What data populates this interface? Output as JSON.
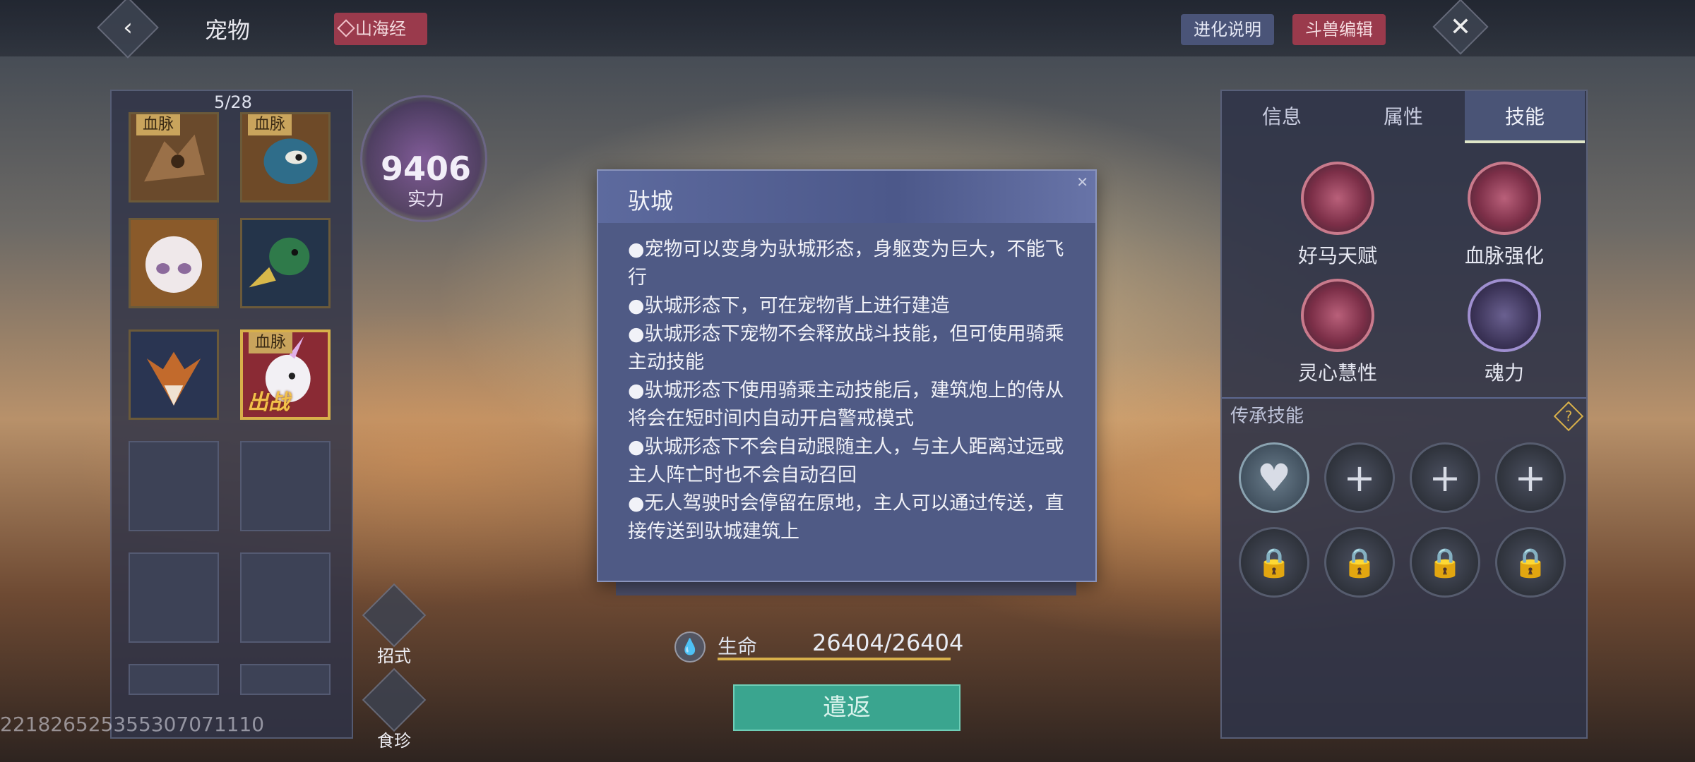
{
  "header": {
    "title": "宠物",
    "shanhai_label": "山海经",
    "evolution_label": "进化说明",
    "beast_edit_label": "斗兽编辑"
  },
  "pet_list": {
    "count": "5/28",
    "bloodline_tag": "血脉",
    "deploy_tag": "出战"
  },
  "power": {
    "value": "9406",
    "label": "实力"
  },
  "side_buttons": {
    "moves": "招式",
    "food": "食珍"
  },
  "stats": {
    "hp_label": "生命",
    "hp_value": "26404/26404"
  },
  "dismiss_label": "遣返",
  "user_id": "221826525355307071110",
  "modal": {
    "title": "驮城",
    "lines": [
      "●宠物可以变身为驮城形态，身躯变为巨大，不能飞行",
      "●驮城形态下，可在宠物背上进行建造",
      "●驮城形态下宠物不会释放战斗技能，但可使用骑乘主动技能",
      "●驮城形态下使用骑乘主动技能后，建筑炮上的侍从将会在短时间内自动开启警戒模式",
      "●驮城形态下不会自动跟随主人，与主人距离过远或主人阵亡时也不会自动召回",
      "●无人驾驶时会停留在原地，主人可以通过传送，直接传送到驮城建筑上"
    ]
  },
  "skill_panel": {
    "tabs": [
      "信息",
      "属性",
      "技能"
    ],
    "skills": [
      "好马天赋",
      "血脉强化",
      "灵心慧性",
      "魂力"
    ],
    "inherit_title": "传承技能",
    "help_glyph": "?"
  }
}
